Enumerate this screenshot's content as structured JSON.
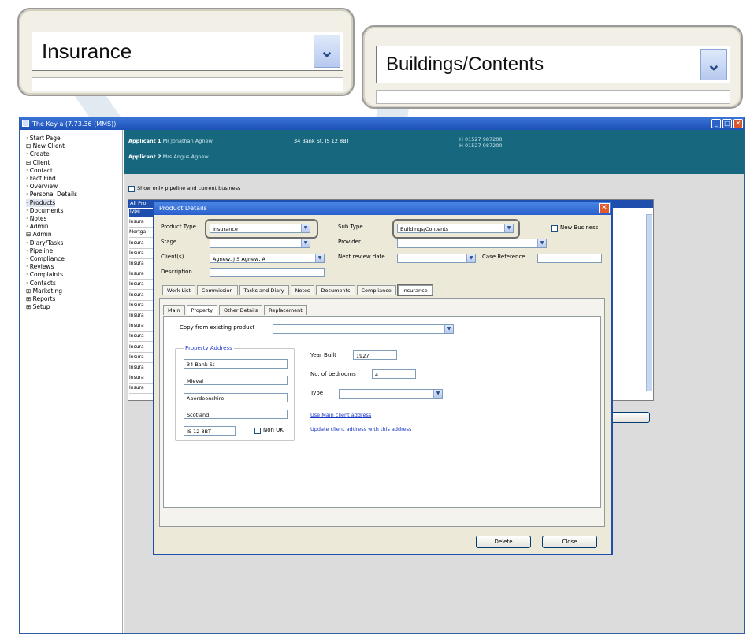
{
  "callouts": {
    "left": {
      "value": "Insurance",
      "arrow": "⌄"
    },
    "right": {
      "value": "Buildings/Contents",
      "arrow": "⌄"
    }
  },
  "window": {
    "title": "The Key a (7.73.36 (MMS))",
    "controls": [
      "_",
      "□",
      "✕"
    ]
  },
  "tree": [
    "· Start Page",
    "⊟ New Client",
    "    · Create",
    "⊟ Client",
    "    · Contact",
    "    · Fact Find",
    "    · Overview",
    "    · Personal Details",
    "    · Products",
    "    · Documents",
    "    · Notes",
    "    · Admin",
    "⊟ Admin",
    "    · Diary/Tasks",
    "    · Pipeline",
    "    · Compliance",
    "    · Reviews",
    "    · Complaints",
    "    · Contacts",
    "⊞ Marketing",
    "⊞ Reports",
    "⊞ Setup"
  ],
  "header": {
    "applicant1_label": "Applicant 1",
    "applicant1_name": "Mr Jonathan Agnew",
    "applicant2_label": "Applicant 2",
    "applicant2_name": "Mrs Angus Agnew",
    "address": "34 Bank St, IS 12 8BT",
    "phone1": "H 01527 987200",
    "phone2": "H 01527 987200"
  },
  "filter_label": "Show only pipeline and current business",
  "list_header": "All Pro",
  "list_rows": [
    "Type",
    "Insura",
    "Mortga",
    "Insura",
    "Insura",
    "Insura",
    "Insura",
    "Insura",
    "Insura",
    "Insura",
    "Insura",
    "Insura",
    "Insura",
    "Insura",
    "Insura",
    "Insura",
    "Insura",
    "Insura"
  ],
  "dialog": {
    "title": "Product Details",
    "close": "✕",
    "product_type_label": "Product Type",
    "product_type": "Insurance",
    "sub_type_label": "Sub Type",
    "sub_type": "Buildings/Contents",
    "new_business_label": "New Business",
    "stage_label": "Stage",
    "provider_label": "Provider",
    "clients_label": "Client(s)",
    "clients": "Agnew, J S Agnew, A",
    "next_review_label": "Next review date",
    "case_ref_label": "Case Reference",
    "description_label": "Description",
    "tabs": [
      "Work List",
      "Commission",
      "Tasks and Diary",
      "Notes",
      "Documents",
      "Compliance",
      "Insurance"
    ],
    "subtabs": [
      "Main",
      "Property",
      "Other Details",
      "Replacement"
    ],
    "copy_label": "Copy from existing product",
    "property_address_label": "Property Address",
    "address_lines": [
      "34 Bank St",
      "Mieval",
      "Aberdeenshire",
      "Scotland",
      "IS 12 8BT"
    ],
    "non_uk_label": "Non UK",
    "year_built_label": "Year Built",
    "year_built": "1927",
    "bedrooms_label": "No. of bedrooms",
    "bedrooms": "4",
    "type_label": "Type",
    "link_main_client": "Use Main client address",
    "link_update_client": "Update client address with this address",
    "delete_button": "Delete",
    "close_button": "Close"
  }
}
